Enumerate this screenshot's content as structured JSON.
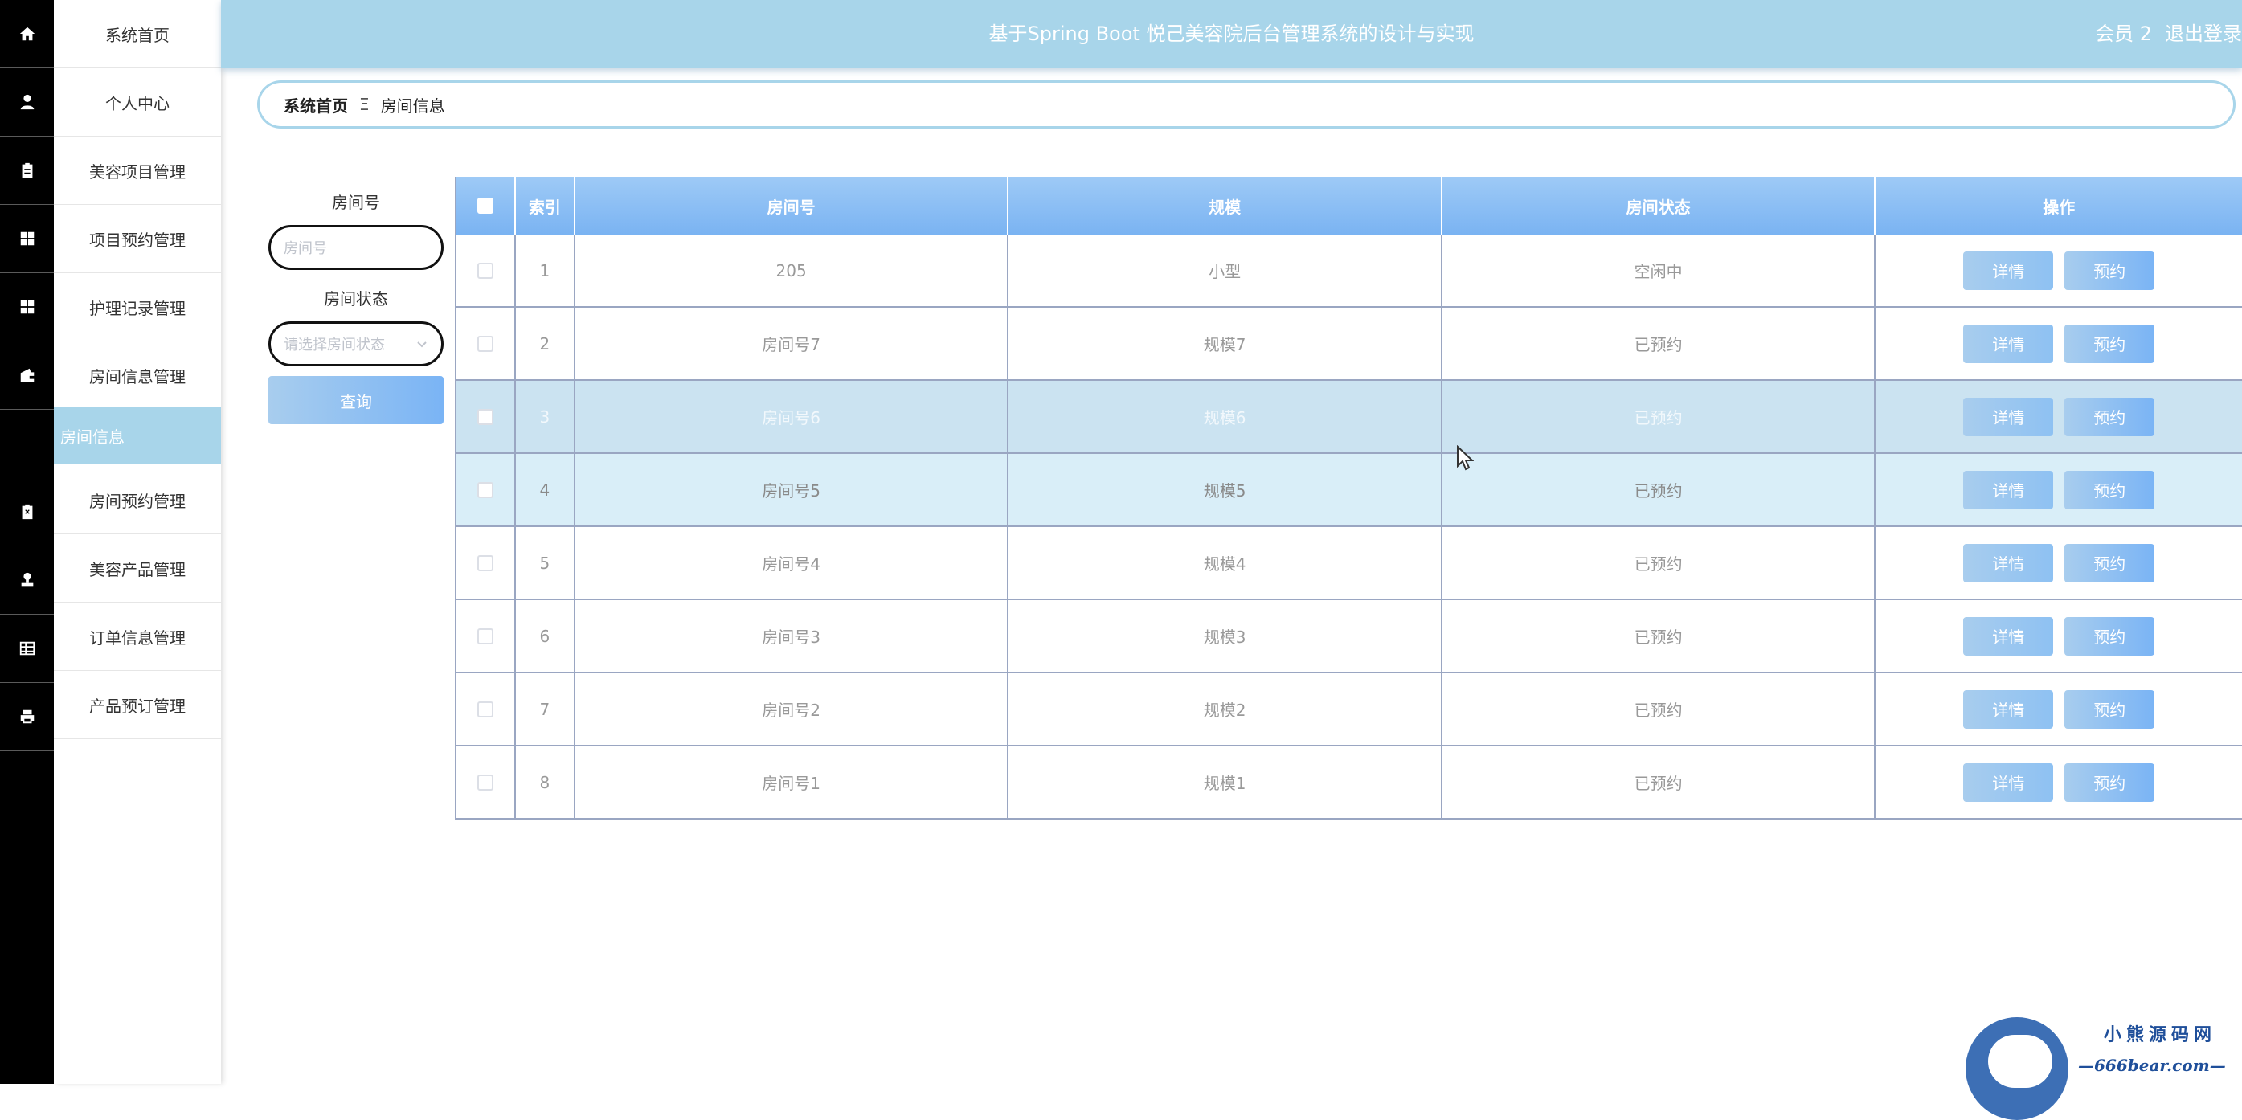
{
  "app": {
    "title": "基于Spring Boot 悦己美容院后台管理系统的设计与实现",
    "user_label": "会员 2",
    "logout_label": "退出登录"
  },
  "sidebar": {
    "items": [
      {
        "label": "系统首页",
        "icon": "home-icon"
      },
      {
        "label": "个人中心",
        "icon": "user-icon"
      },
      {
        "label": "美容项目管理",
        "icon": "clipboard-icon"
      },
      {
        "label": "项目预约管理",
        "icon": "grid-icon"
      },
      {
        "label": "护理记录管理",
        "icon": "grid-icon"
      },
      {
        "label": "房间信息管理",
        "icon": "wallet-icon"
      },
      {
        "label": "房间预约管理",
        "icon": "clipboard-x-icon"
      },
      {
        "label": "美容产品管理",
        "icon": "stamp-icon"
      },
      {
        "label": "订单信息管理",
        "icon": "table-icon"
      },
      {
        "label": "产品预订管理",
        "icon": "printer-icon"
      }
    ],
    "active_sub": "房间信息"
  },
  "breadcrumb": {
    "home": "系统首页",
    "separator": "Ξ",
    "current": "房间信息"
  },
  "search": {
    "room_no_label": "房间号",
    "room_no_placeholder": "房间号",
    "status_label": "房间状态",
    "status_placeholder": "请选择房间状态",
    "query_label": "查询"
  },
  "table": {
    "headers": [
      "索引",
      "房间号",
      "规模",
      "房间状态",
      "操作"
    ],
    "detail_label": "详情",
    "book_label": "预约",
    "rows": [
      {
        "index": "1",
        "room_no": "205",
        "scale": "小型",
        "status": "空闲中"
      },
      {
        "index": "2",
        "room_no": "房间号7",
        "scale": "规模7",
        "status": "已预约"
      },
      {
        "index": "3",
        "room_no": "房间号6",
        "scale": "规模6",
        "status": "已预约"
      },
      {
        "index": "4",
        "room_no": "房间号5",
        "scale": "规模5",
        "status": "已预约"
      },
      {
        "index": "5",
        "room_no": "房间号4",
        "scale": "规模4",
        "status": "已预约"
      },
      {
        "index": "6",
        "room_no": "房间号3",
        "scale": "规模3",
        "status": "已预约"
      },
      {
        "index": "7",
        "room_no": "房间号2",
        "scale": "规模2",
        "status": "已预约"
      },
      {
        "index": "8",
        "room_no": "房间号1",
        "scale": "规模1",
        "status": "已预约"
      }
    ]
  },
  "watermark": {
    "line1": "小熊源码网",
    "line2": "—666bear.com—"
  },
  "colors": {
    "topbar": "#a8d5ea",
    "header_gradient_start": "#9ecaf6",
    "header_gradient_end": "#7ab3f2",
    "row_highlight": "#cbe3f1",
    "row_hover": "#d9eef8"
  }
}
